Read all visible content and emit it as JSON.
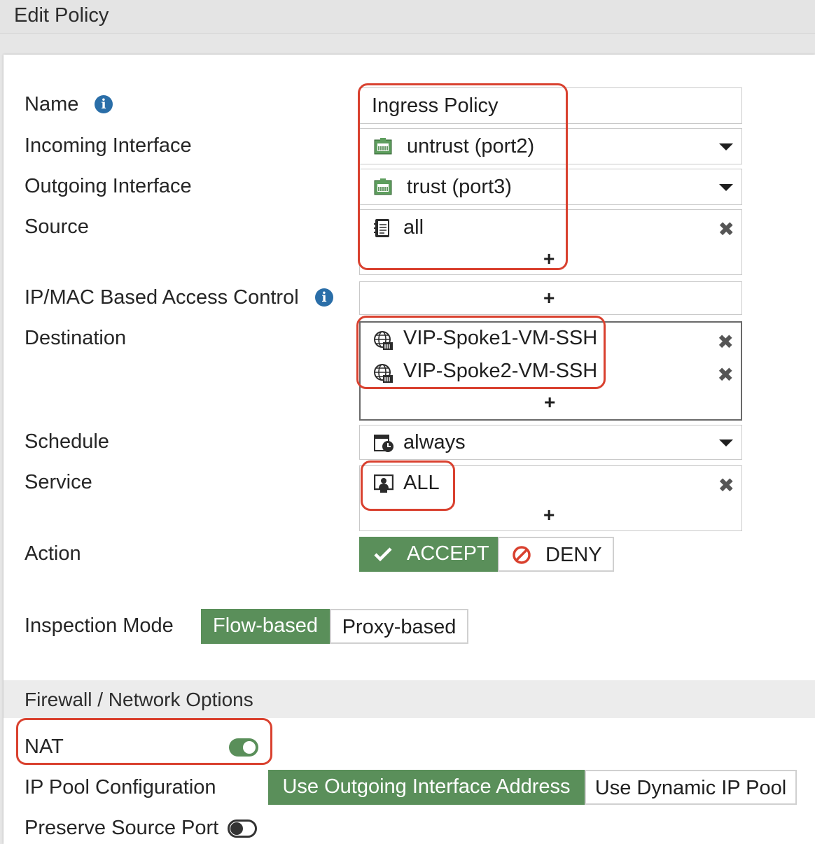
{
  "window": {
    "title": "Edit Policy"
  },
  "labels": {
    "name": "Name",
    "incoming_interface": "Incoming Interface",
    "outgoing_interface": "Outgoing Interface",
    "source": "Source",
    "ipmac": "IP/MAC Based Access Control",
    "destination": "Destination",
    "schedule": "Schedule",
    "service": "Service",
    "action": "Action",
    "inspection_mode": "Inspection Mode",
    "nat": "NAT",
    "ip_pool_configuration": "IP Pool Configuration",
    "preserve_source_port": "Preserve Source Port"
  },
  "fields": {
    "name_value": "Ingress Policy",
    "incoming_interface": {
      "value": "untrust (port2)",
      "icon": "network-port-icon"
    },
    "outgoing_interface": {
      "value": "trust (port3)",
      "icon": "network-port-icon"
    },
    "source": {
      "items": [
        "all"
      ],
      "icon": "address-book-icon"
    },
    "ipmac": {
      "items": []
    },
    "destination": {
      "items": [
        "VIP-Spoke1-VM-SSH",
        "VIP-Spoke2-VM-SSH"
      ],
      "icon": "globe-vip-icon"
    },
    "schedule": {
      "value": "always",
      "icon": "calendar-clock-icon"
    },
    "service": {
      "items": [
        "ALL"
      ],
      "icon": "service-monitor-icon"
    }
  },
  "action": {
    "accept_label": "ACCEPT",
    "deny_label": "DENY",
    "selected": "ACCEPT"
  },
  "inspection_mode": {
    "options": [
      "Flow-based",
      "Proxy-based"
    ],
    "selected": "Flow-based"
  },
  "section": {
    "title": "Firewall / Network Options"
  },
  "nat": {
    "enabled": true
  },
  "ip_pool": {
    "options": [
      "Use Outgoing Interface Address",
      "Use Dynamic IP Pool"
    ],
    "selected": "Use Outgoing Interface Address"
  },
  "preserve_source_port": {
    "enabled": false
  },
  "colors": {
    "accent_green": "#5a8f5a",
    "highlight_red": "#d9412f",
    "info_blue": "#2a6ea8"
  }
}
